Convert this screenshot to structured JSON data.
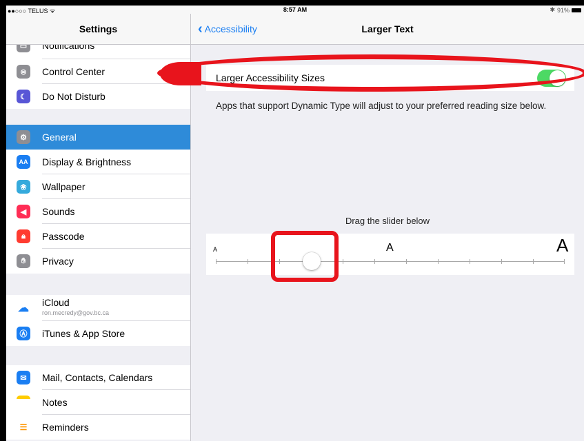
{
  "status_bar": {
    "carrier": "●●○○○ TELUS ᯤ",
    "time": "8:57 AM",
    "battery": "91%"
  },
  "sidebar": {
    "title": "Settings",
    "items": [
      {
        "label": "Notifications",
        "icon": "notifications-icon",
        "color": "#8e8e93"
      },
      {
        "label": "Control Center",
        "icon": "control-center-icon",
        "color": "#8e8e93"
      },
      {
        "label": "Do Not Disturb",
        "icon": "moon-icon",
        "color": "#5856d6"
      },
      {
        "label": "General",
        "icon": "gear-icon",
        "color": "#8e8e93",
        "selected": true
      },
      {
        "label": "Display & Brightness",
        "icon": "display-icon",
        "color": "#1a7ef2"
      },
      {
        "label": "Wallpaper",
        "icon": "wallpaper-icon",
        "color": "#35aadc"
      },
      {
        "label": "Sounds",
        "icon": "speaker-icon",
        "color": "#ff2d55"
      },
      {
        "label": "Passcode",
        "icon": "lock-icon",
        "color": "#ff3b30"
      },
      {
        "label": "Privacy",
        "icon": "hand-icon",
        "color": "#8e8e93"
      },
      {
        "label": "iCloud",
        "sublabel": "ron.mecredy@gov.bc.ca",
        "icon": "cloud-icon",
        "color": "#ffffff"
      },
      {
        "label": "iTunes & App Store",
        "icon": "app-store-icon",
        "color": "#1a7ef2"
      },
      {
        "label": "Mail, Contacts, Calendars",
        "icon": "mail-icon",
        "color": "#1a7ef2"
      },
      {
        "label": "Notes",
        "icon": "notes-icon",
        "color": "#ffcc00"
      },
      {
        "label": "Reminders",
        "icon": "reminders-icon",
        "color": "#ffffff"
      }
    ]
  },
  "detail": {
    "back_label": "Accessibility",
    "title": "Larger Text",
    "toggle_label": "Larger Accessibility Sizes",
    "toggle_on": true,
    "hint": "Apps that support Dynamic Type will adjust to your preferred reading size below.",
    "drag_label": "Drag the slider below",
    "slider": {
      "small_label": "A",
      "mid_label": "A",
      "big_label": "A",
      "steps": 12,
      "value_index": 3
    }
  },
  "colors": {
    "accent": "#1a7ef2",
    "toggle_on": "#4cd964",
    "selected_row": "#2e8bd9",
    "annotation": "#e8141c"
  }
}
